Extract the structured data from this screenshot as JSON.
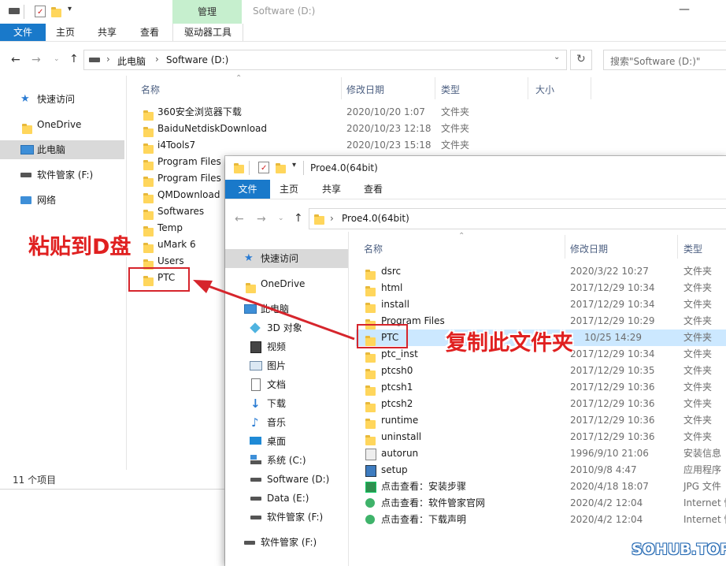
{
  "back_window": {
    "title": "Software (D:)",
    "context_tab_header": "管理",
    "ribbon_tabs": {
      "file": "文件",
      "home": "主页",
      "share": "共享",
      "view": "查看",
      "drive_tools": "驱动器工具"
    },
    "breadcrumb": {
      "this_pc": "此电脑",
      "drive": "Software (D:)",
      "separator": "›"
    },
    "search_placeholder": "搜索\"Software (D:)\"",
    "columns": {
      "name": "名称",
      "date": "修改日期",
      "type": "类型",
      "size": "大小"
    },
    "sidebar": [
      {
        "label": "快速访问",
        "icon": "star-icon"
      },
      {
        "label": "OneDrive",
        "icon": "folder-icon"
      },
      {
        "label": "此电脑",
        "icon": "computer-icon"
      },
      {
        "label": "软件管家 (F:)",
        "icon": "drive-icon"
      },
      {
        "label": "网络",
        "icon": "network-icon"
      }
    ],
    "files": [
      {
        "name": "360安全浏览器下载",
        "date": "2020/10/20 1:07",
        "type": "文件夹"
      },
      {
        "name": "BaiduNetdiskDownload",
        "date": "2020/10/23 12:18",
        "type": "文件夹"
      },
      {
        "name": "i4Tools7",
        "date": "2020/10/23 15:18",
        "type": "文件夹"
      },
      {
        "name": "Program Files",
        "date": "",
        "type": ""
      },
      {
        "name": "Program Files",
        "date": "",
        "type": ""
      },
      {
        "name": "QMDownload",
        "date": "",
        "type": ""
      },
      {
        "name": "Softwares",
        "date": "",
        "type": ""
      },
      {
        "name": "Temp",
        "date": "",
        "type": ""
      },
      {
        "name": "uMark 6",
        "date": "",
        "type": ""
      },
      {
        "name": "Users",
        "date": "",
        "type": ""
      },
      {
        "name": "PTC",
        "date": "",
        "type": ""
      }
    ],
    "status": "11 个项目"
  },
  "front_window": {
    "title": "Proe4.0(64bit)",
    "ribbon_tabs": {
      "file": "文件",
      "home": "主页",
      "share": "共享",
      "view": "查看"
    },
    "breadcrumb": {
      "folder": "Proe4.0(64bit)",
      "separator": "›"
    },
    "columns": {
      "name": "名称",
      "date": "修改日期",
      "type": "类型"
    },
    "sidebar": [
      {
        "label": "快速访问",
        "icon": "star-icon"
      },
      {
        "label": "OneDrive",
        "icon": "folder-icon"
      },
      {
        "label": "此电脑",
        "icon": "computer-icon"
      },
      {
        "label": "3D 对象",
        "icon": "cube-icon"
      },
      {
        "label": "视频",
        "icon": "video-icon"
      },
      {
        "label": "图片",
        "icon": "picture-icon"
      },
      {
        "label": "文档",
        "icon": "document-icon"
      },
      {
        "label": "下载",
        "icon": "download-icon"
      },
      {
        "label": "音乐",
        "icon": "music-icon"
      },
      {
        "label": "桌面",
        "icon": "desktop-icon"
      },
      {
        "label": "系统 (C:)",
        "icon": "windows-drive-icon"
      },
      {
        "label": "Software (D:)",
        "icon": "drive-icon"
      },
      {
        "label": "Data (E:)",
        "icon": "drive-icon"
      },
      {
        "label": "软件管家 (F:)",
        "icon": "drive-icon"
      },
      {
        "label": "软件管家 (F:)",
        "icon": "drive-icon"
      }
    ],
    "files": [
      {
        "name": "dsrc",
        "date": "2020/3/22 10:27",
        "type": "文件夹",
        "icon": "folder-icon"
      },
      {
        "name": "html",
        "date": "2017/12/29 10:34",
        "type": "文件夹",
        "icon": "folder-icon"
      },
      {
        "name": "install",
        "date": "2017/12/29 10:34",
        "type": "文件夹",
        "icon": "folder-icon"
      },
      {
        "name": "Program Files",
        "date": "2017/12/29 10:29",
        "type": "文件夹",
        "icon": "folder-icon"
      },
      {
        "name": "PTC",
        "date": "10/25 14:29",
        "type": "文件夹",
        "icon": "folder-icon"
      },
      {
        "name": "ptc_inst",
        "date": "2017/12/29 10:34",
        "type": "文件夹",
        "icon": "folder-icon"
      },
      {
        "name": "ptcsh0",
        "date": "2017/12/29 10:35",
        "type": "文件夹",
        "icon": "folder-icon"
      },
      {
        "name": "ptcsh1",
        "date": "2017/12/29 10:36",
        "type": "文件夹",
        "icon": "folder-icon"
      },
      {
        "name": "ptcsh2",
        "date": "2017/12/29 10:36",
        "type": "文件夹",
        "icon": "folder-icon"
      },
      {
        "name": "runtime",
        "date": "2017/12/29 10:36",
        "type": "文件夹",
        "icon": "folder-icon"
      },
      {
        "name": "uninstall",
        "date": "2017/12/29 10:36",
        "type": "文件夹",
        "icon": "folder-icon"
      },
      {
        "name": "autorun",
        "date": "1996/9/10 21:06",
        "type": "安装信息",
        "icon": "setup-info-icon"
      },
      {
        "name": "setup",
        "date": "2010/9/8 4:47",
        "type": "应用程序",
        "icon": "setup-app-icon"
      },
      {
        "name": "点击查看：安装步骤",
        "date": "2020/4/18 18:07",
        "type": "JPG 文件",
        "icon": "jpg-icon"
      },
      {
        "name": "点击查看：软件管家官网",
        "date": "2020/4/2 12:04",
        "type": "Internet 快",
        "icon": "internet-shortcut-icon"
      },
      {
        "name": "点击查看：下载声明",
        "date": "2020/4/2 12:04",
        "type": "Internet 快",
        "icon": "internet-shortcut-icon"
      }
    ]
  },
  "annotations": {
    "paste": "粘贴到D盘",
    "copy": "复制此文件夹",
    "color": "#e02020"
  },
  "watermark": "SOHUB.TOP",
  "colors": {
    "file_tab": "#1979ca",
    "selection": "#cce8ff",
    "context_tab": "#c6efce",
    "folder": "#ffd65c"
  }
}
